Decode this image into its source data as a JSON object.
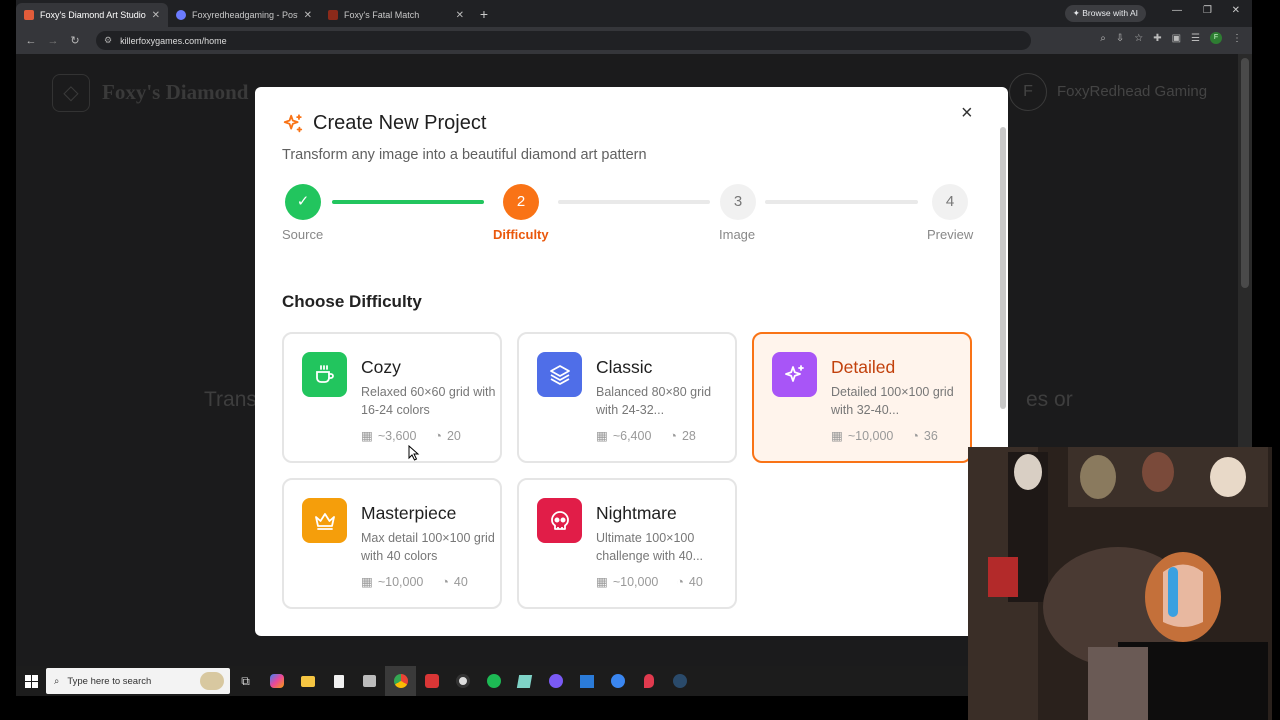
{
  "browser": {
    "tabs": [
      {
        "title": "Foxy's Diamond Art Studio",
        "active": true,
        "favicon_color": "#e25c3a"
      },
      {
        "title": "Foxyredheadgaming - Poster (L",
        "active": false,
        "favicon_color": "#6b7bff"
      },
      {
        "title": "Foxy's Fatal Match",
        "active": false,
        "favicon_color": "#8b2a1a"
      }
    ],
    "new_tab": "+",
    "browse_ai": "Browse with AI",
    "url": "killerfoxygames.com/home",
    "profile_initial": "F"
  },
  "background_page": {
    "site_title": "Foxy's Diamond",
    "user_initial": "F",
    "user_name": "FoxyRedhead Gaming",
    "hero_left": "Trans",
    "hero_right": "es or"
  },
  "modal": {
    "title": "Create New Project",
    "subtitle": "Transform any image into a beautiful diamond art pattern",
    "close": "×",
    "steps": [
      {
        "number": "✓",
        "label": "Source",
        "state": "done"
      },
      {
        "number": "2",
        "label": "Difficulty",
        "state": "current"
      },
      {
        "number": "3",
        "label": "Image",
        "state": "todo"
      },
      {
        "number": "4",
        "label": "Preview",
        "state": "todo"
      }
    ],
    "section_title": "Choose Difficulty",
    "cards": [
      {
        "name": "Cozy",
        "desc": "Relaxed 60×60 grid with 16-24 colors",
        "cells": "~3,600",
        "colors": "20",
        "icon": "coffee-icon",
        "color": "#22c55e",
        "selected": false
      },
      {
        "name": "Classic",
        "desc": "Balanced 80×80 grid with 24-32...",
        "cells": "~6,400",
        "colors": "28",
        "icon": "layers-icon",
        "color": "#4f6ee8",
        "selected": false
      },
      {
        "name": "Detailed",
        "desc": "Detailed 100×100 grid with 32-40...",
        "cells": "~10,000",
        "colors": "36",
        "icon": "sparkles-icon",
        "color": "#a855f7",
        "selected": true
      },
      {
        "name": "Masterpiece",
        "desc": "Max detail 100×100 grid with 40 colors",
        "cells": "~10,000",
        "colors": "40",
        "icon": "crown-icon",
        "color": "#f59e0b",
        "selected": false
      },
      {
        "name": "Nightmare",
        "desc": "Ultimate 100×100 challenge with 40...",
        "cells": "~10,000",
        "colors": "40",
        "icon": "skull-icon",
        "color": "#e11d48",
        "selected": false
      }
    ]
  },
  "taskbar": {
    "search_placeholder": "Type here to search"
  }
}
